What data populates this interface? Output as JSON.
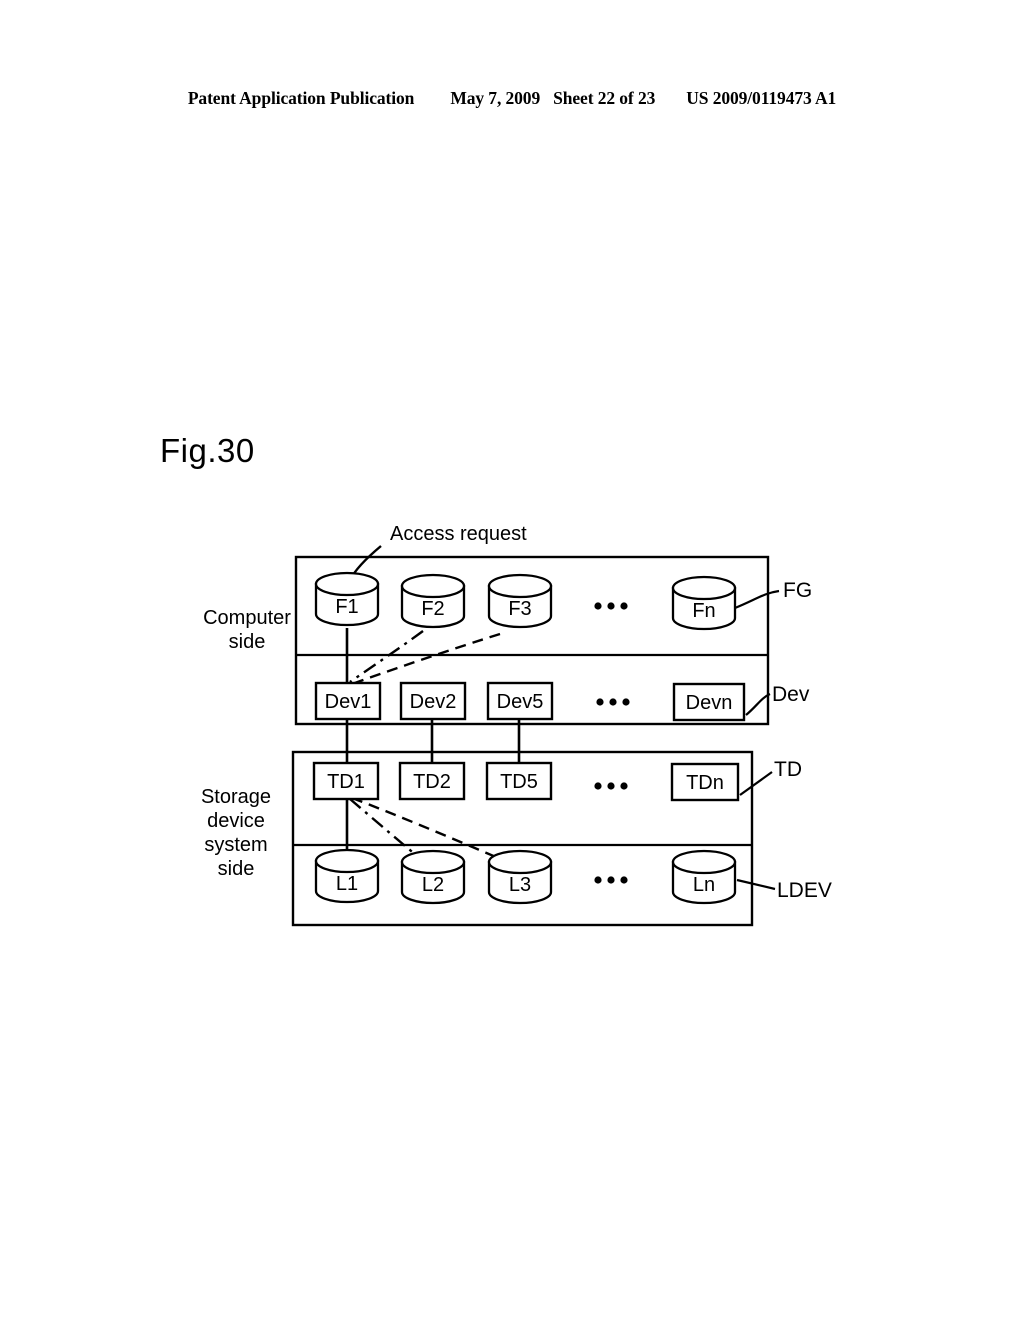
{
  "header": {
    "publication": "Patent Application Publication",
    "date": "May 7, 2009",
    "sheet": "Sheet 22 of 23",
    "patent_number": "US 2009/0119473 A1"
  },
  "figure": {
    "label": "Fig.30",
    "annotation": "Access request",
    "side_labels": {
      "computer": [
        "Computer",
        "side"
      ],
      "storage": [
        "Storage",
        "device",
        "system",
        "side"
      ]
    },
    "leader_labels": {
      "fg": "FG",
      "dev": "Dev",
      "td": "TD",
      "ldev": "LDEV"
    },
    "ellipsis": "•••",
    "rows": {
      "fg": {
        "name": "FG",
        "shape": "cylinder",
        "nodes": [
          "F1",
          "F2",
          "F3",
          "Fn"
        ]
      },
      "dev": {
        "name": "Dev",
        "shape": "rect",
        "nodes": [
          "Dev1",
          "Dev2",
          "Dev5",
          "Devn"
        ]
      },
      "td": {
        "name": "TD",
        "shape": "rect",
        "nodes": [
          "TD1",
          "TD2",
          "TD5",
          "TDn"
        ]
      },
      "ldev": {
        "name": "LDEV",
        "shape": "cylinder",
        "nodes": [
          "L1",
          "L2",
          "L3",
          "Ln"
        ]
      }
    },
    "colors": {
      "ink": "#000000",
      "paper": "#ffffff"
    }
  }
}
